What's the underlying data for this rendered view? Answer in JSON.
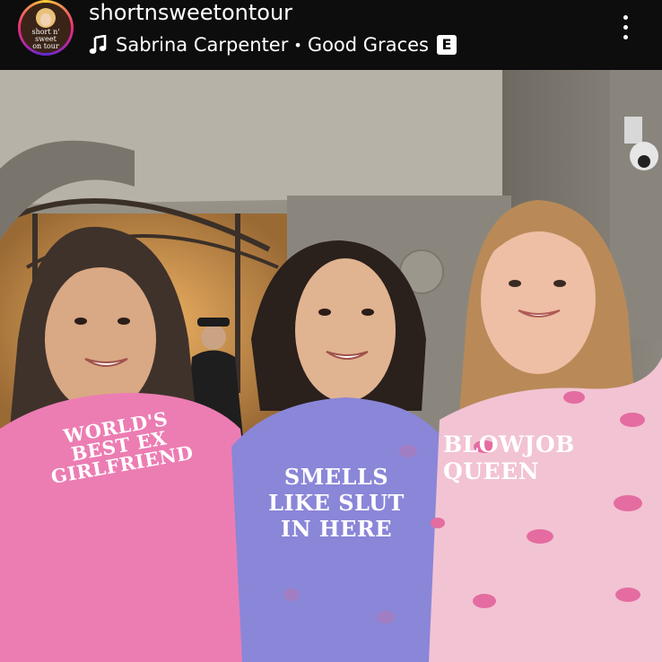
{
  "post_header": {
    "username": "shortnsweetontour",
    "avatar_text": [
      "short n'",
      "sweet",
      "on tour"
    ],
    "music": {
      "artist": "Sabrina Carpenter",
      "separator": "•",
      "song": "Good Graces",
      "explicit_badge": "E"
    },
    "icons": {
      "music": "music-note-icon",
      "more": "more-options-icon"
    }
  },
  "photo": {
    "shirt_left": [
      "WORLD'S",
      "BEST EX",
      "GIRLFRIEND"
    ],
    "shirt_middle": [
      "SMELLS",
      "LIKE SLUT",
      "IN HERE"
    ],
    "shirt_right": [
      "BLOWJOB",
      "QUEEN"
    ],
    "colors": {
      "shirt_left": "#ec7db3",
      "shirt_middle": "#8a86d8",
      "shirt_right": "#f2c3d3"
    }
  }
}
